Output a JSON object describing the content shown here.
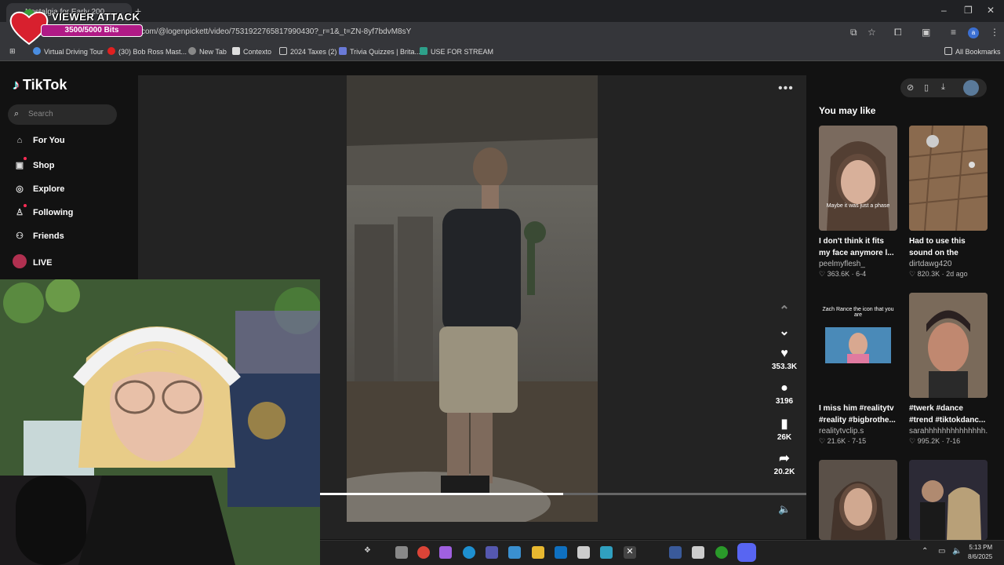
{
  "browser": {
    "tab_title": "Nostalgia for Early 200...",
    "url": "com/@logenpickett/video/7531922765817990430?_r=1&_t=ZN-8yf7bdvM8sY",
    "bookmarks": [
      "Virtual Driving Tour",
      "(30) Bob Ross Mast...",
      "New Tab",
      "Contexto",
      "2024 Taxes (2)",
      "Trivia Quizzes | Brita...",
      "USE FOR STREAM"
    ],
    "all_bookmarks": "All Bookmarks",
    "profile_initial": "a"
  },
  "overlay": {
    "title": "VIEWER ATTACK",
    "bits": "3500/5000 Bits",
    "bits_progress": 0.7
  },
  "tiktok": {
    "logo": "TikTok",
    "search_placeholder": "Search",
    "nav": [
      "For You",
      "Shop",
      "Explore",
      "Following",
      "Friends",
      "LIVE"
    ]
  },
  "video": {
    "likes": "353.3K",
    "comments": "3196",
    "saves": "26K",
    "shares": "20.2K",
    "progress": 0.5
  },
  "side": {
    "heading": "You may like",
    "cards": [
      {
        "title": "I don't think it fits my face anymore l...",
        "user": "peelmyflesh_",
        "likes": "363.6K",
        "date": "6-4",
        "caption": "Maybe it was just a phase",
        "color": "#7a6a5e"
      },
      {
        "title": "Had to use this sound on the origin...",
        "user": "dirtdawg420",
        "likes": "820.3K",
        "date": "2d ago",
        "caption": "",
        "color": "#8a6a4e"
      },
      {
        "title": "I miss him #realitytv #reality #bigbrothe...",
        "user": "realitytvclip.s",
        "likes": "21.6K",
        "date": "7-15",
        "caption": "Zach Rance the icon that you are",
        "color": "#121212"
      },
      {
        "title": "#twerk #dance #trend #tiktokdanc...",
        "user": "sarahhhhhhhhhhhhhh...",
        "likes": "995.2K",
        "date": "7-16",
        "caption": "",
        "color": "#6a5548"
      },
      {
        "title": "",
        "user": "",
        "likes": "",
        "date": "",
        "caption": "",
        "color": "#5a5048"
      },
      {
        "title": "",
        "user": "",
        "likes": "",
        "date": "",
        "caption": "",
        "color": "#2c2a36"
      }
    ]
  },
  "taskbar": {
    "time": "5:13 PM",
    "date": "8/6/2025"
  }
}
